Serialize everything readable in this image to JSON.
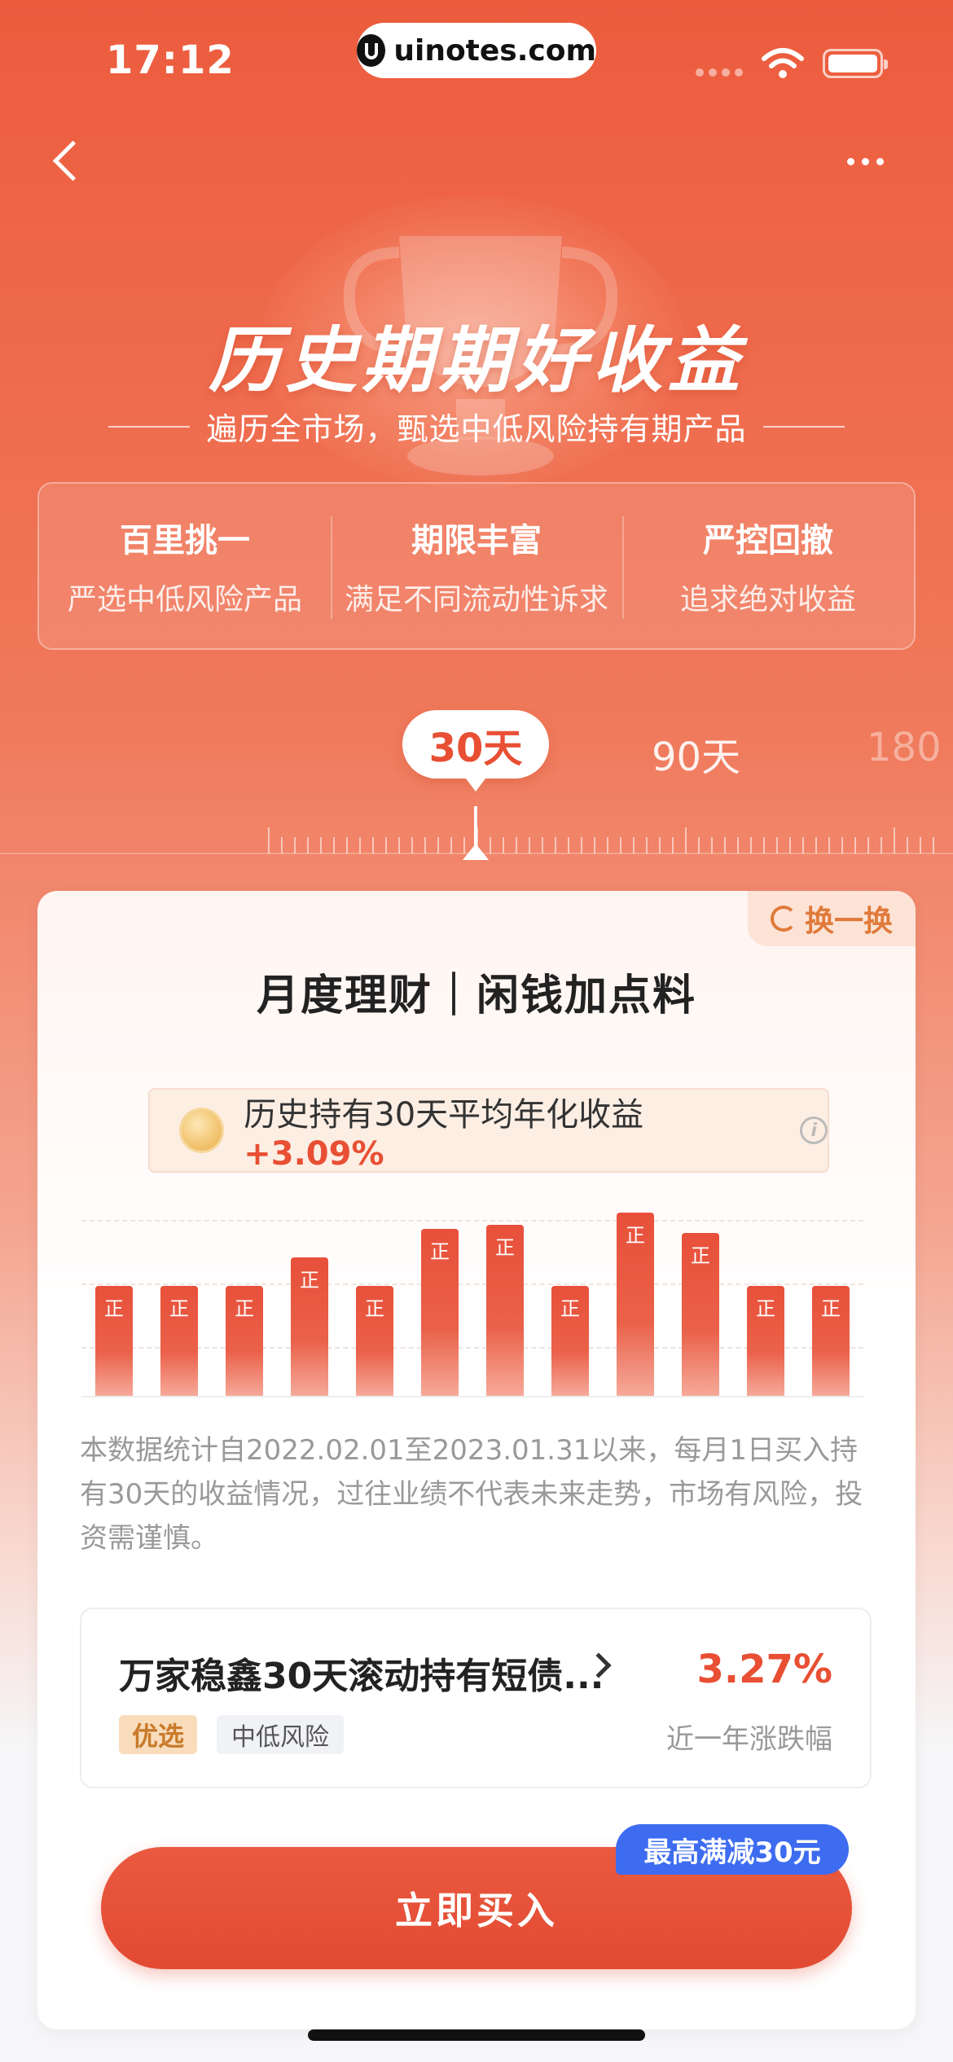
{
  "status_bar": {
    "time": "17:12",
    "url": "uinotes.com"
  },
  "hero": {
    "title": "历史期期好收益",
    "subtitle": "遍历全市场，甄选中低风险持有期产品"
  },
  "features": [
    {
      "title": "百里挑一",
      "desc": "严选中低风险产品"
    },
    {
      "title": "期限丰富",
      "desc": "满足不同流动性诉求"
    },
    {
      "title": "严控回撤",
      "desc": "追求绝对收益"
    }
  ],
  "periods": {
    "active": "30天",
    "second": "90天",
    "third": "180"
  },
  "card": {
    "swap_label": "换一换",
    "title": "月度理财｜闲钱加点料",
    "avg_prefix": "历史持有30天平均年化收益",
    "avg_value": "+3.09%",
    "info_glyph": "i",
    "disclaimer": "本数据统计自2022.02.01至2023.01.31以来，每月1日买入持有30天的收益情况，过往业绩不代表未来走势，市场有风险，投资需谨慎。"
  },
  "chart_data": {
    "type": "bar",
    "bar_label": "正",
    "values": [
      2.7,
      2.7,
      2.7,
      3.4,
      2.7,
      4.1,
      4.2,
      2.7,
      4.5,
      4.0,
      2.7,
      2.7
    ],
    "ylim": [
      0,
      5
    ]
  },
  "product": {
    "name": "万家稳鑫30天滚动持有短债...",
    "tag_pick": "优选",
    "tag_risk": "中低风险",
    "rate": "3.27%",
    "rate_label": "近一年涨跌幅"
  },
  "cta": {
    "buy_label": "立即买入",
    "promo": "最高满减30元"
  },
  "colors": {
    "brand": "#e84f33",
    "promo": "#3d6cf0"
  }
}
